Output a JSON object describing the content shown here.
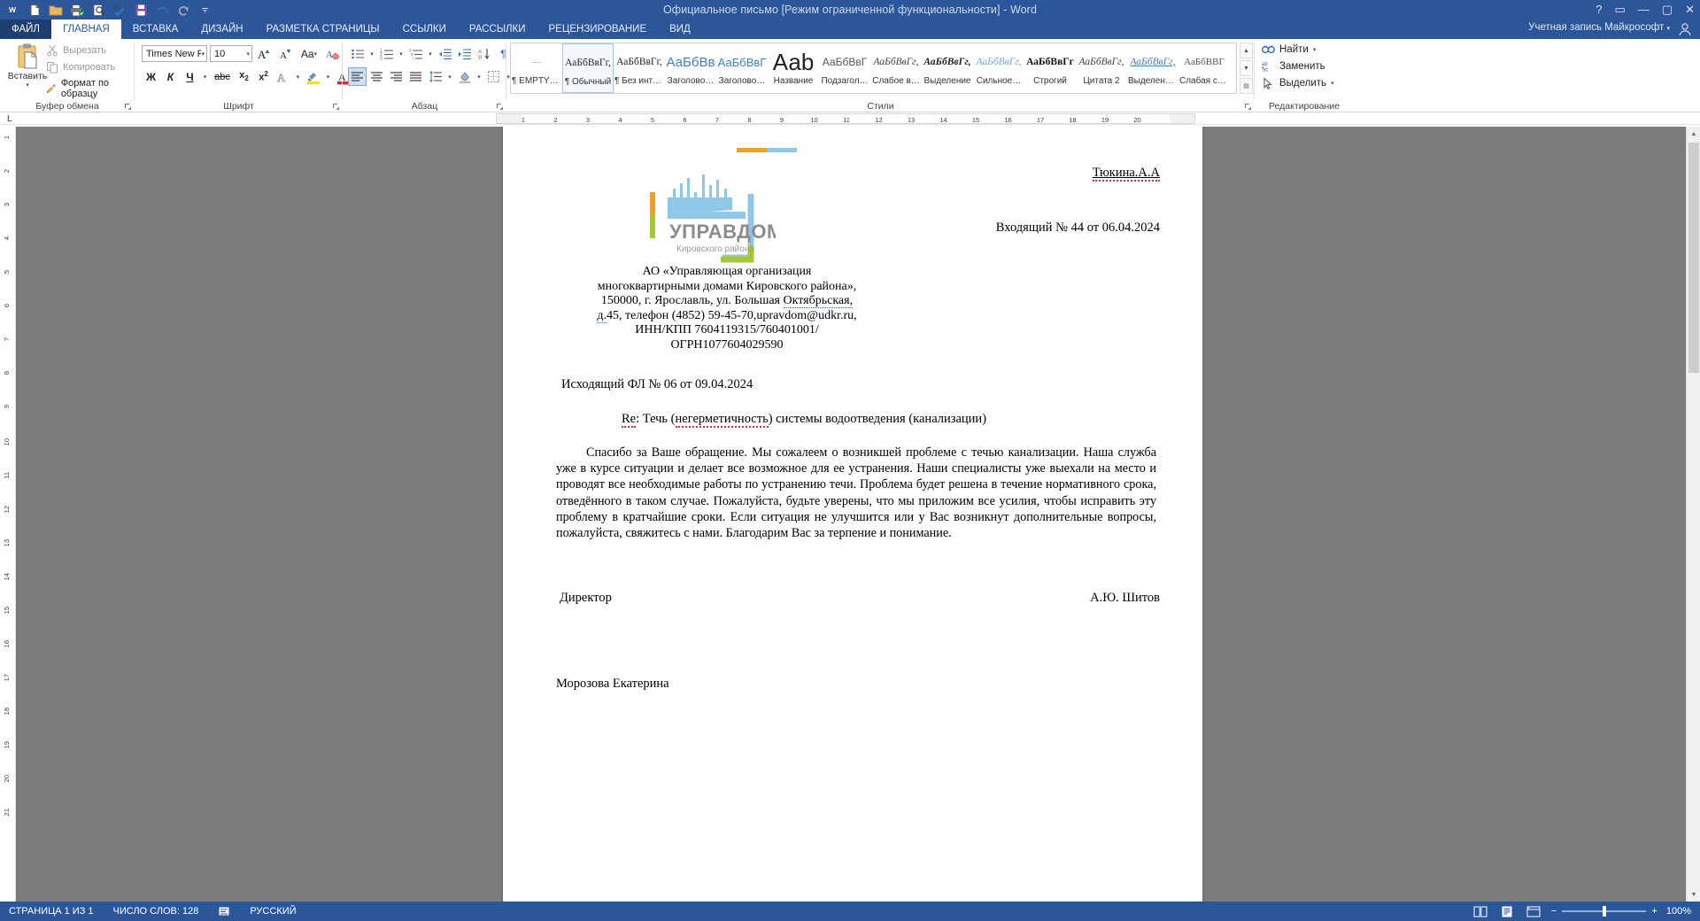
{
  "window": {
    "title": "Официальное письмо [Режим ограниченной функциональности] - Word",
    "minimize": "—",
    "maximize": "▢",
    "close": "✕",
    "help": "?",
    "ribbon_display": "▭"
  },
  "quick_access": [
    {
      "name": "word-logo-icon",
      "glyph": "W"
    },
    {
      "name": "new-document-icon",
      "glyph": "🗋"
    },
    {
      "name": "open-folder-icon",
      "glyph": "🗀"
    },
    {
      "name": "print-icon",
      "glyph": "🖶"
    },
    {
      "name": "print-preview-icon",
      "glyph": "🔍"
    },
    {
      "name": "spelling-check-icon",
      "glyph": "ABC"
    },
    {
      "name": "save-icon",
      "glyph": "💾"
    },
    {
      "name": "undo-icon",
      "glyph": "↩"
    },
    {
      "name": "redo-icon",
      "glyph": "↻"
    },
    {
      "name": "customize-qat-icon",
      "glyph": "▾"
    }
  ],
  "tabs": {
    "file": "ФАЙЛ",
    "items": [
      {
        "label": "ГЛАВНАЯ",
        "active": true
      },
      {
        "label": "ВСТАВКА",
        "active": false
      },
      {
        "label": "ДИЗАЙН",
        "active": false
      },
      {
        "label": "РАЗМЕТКА СТРАНИЦЫ",
        "active": false
      },
      {
        "label": "ССЫЛКИ",
        "active": false
      },
      {
        "label": "РАССЫЛКИ",
        "active": false
      },
      {
        "label": "РЕЦЕНЗИРОВАНИЕ",
        "active": false
      },
      {
        "label": "ВИД",
        "active": false
      }
    ],
    "account": "Учетная запись Майкрософт"
  },
  "ribbon": {
    "clipboard": {
      "group_label": "Буфер обмена",
      "paste_label": "Вставить",
      "cut_label": "Вырезать",
      "copy_label": "Копировать",
      "format_painter_label": "Формат по образцу"
    },
    "font": {
      "group_label": "Шрифт",
      "family": "Times New R",
      "size": "10",
      "grow_label": "A",
      "shrink_label": "A",
      "change_case_label": "Aa",
      "clear_format_label": "⌫",
      "bold": "Ж",
      "italic": "К",
      "underline": "Ч",
      "strikethrough": "abc",
      "subscript": "x₂",
      "superscript": "x²",
      "text_effects": "A",
      "highlight": "ab",
      "font_color": "A"
    },
    "paragraph": {
      "group_label": "Абзац"
    },
    "styles": {
      "group_label": "Стили",
      "items": [
        {
          "name": "¶ EMPTY_...",
          "preview": "—",
          "style": "empty",
          "selected": false
        },
        {
          "name": "¶ Обычный",
          "preview": "АаБбВвГг,",
          "style": "normal",
          "selected": true
        },
        {
          "name": "¶ Без инте…",
          "preview": "АаБбВвГг,",
          "style": "normal",
          "selected": false
        },
        {
          "name": "Заголово…",
          "preview": "АаБбВв",
          "style": "h1",
          "selected": false
        },
        {
          "name": "Заголово…",
          "preview": "АаБбВвГ",
          "style": "h2",
          "selected": false
        },
        {
          "name": "Название",
          "preview": "Ааb",
          "style": "title",
          "selected": false
        },
        {
          "name": "Подзагол…",
          "preview": "АаБбВвГ",
          "style": "subtitle",
          "selected": false
        },
        {
          "name": "Слабое в…",
          "preview": "АаБбВвГг,",
          "style": "subtle-em",
          "selected": false
        },
        {
          "name": "Выделение",
          "preview": "АаБбВвГг,",
          "style": "em",
          "selected": false
        },
        {
          "name": "Сильное…",
          "preview": "АаБбВвГг,",
          "style": "intense-em",
          "selected": false
        },
        {
          "name": "Строгий",
          "preview": "АаБбВвГг",
          "style": "strong",
          "selected": false
        },
        {
          "name": "Цитата 2",
          "preview": "АаБбВвГг,",
          "style": "quote",
          "selected": false
        },
        {
          "name": "Выделенн…",
          "preview": "АаБбВвГг,",
          "style": "intense-ref",
          "selected": false
        },
        {
          "name": "Слабая сс…",
          "preview": "АаБбВВГ",
          "style": "subtle-ref",
          "selected": false
        }
      ]
    },
    "editing": {
      "group_label": "Редактирование",
      "find_label": "Найти",
      "replace_label": "Заменить",
      "select_label": "Выделить"
    }
  },
  "ruler": {
    "corner_tab": "L",
    "h_ticks": [
      "1",
      "2",
      "3",
      "4",
      "5",
      "6",
      "7",
      "8",
      "9",
      "10",
      "11",
      "12",
      "13",
      "14",
      "15",
      "16",
      "17",
      "18",
      "19",
      "20"
    ],
    "v_ticks": [
      "1",
      "2",
      "3",
      "4",
      "5",
      "6",
      "7",
      "8",
      "9",
      "10",
      "11",
      "12",
      "13",
      "14",
      "15",
      "16",
      "17",
      "18",
      "19",
      "20",
      "21"
    ]
  },
  "document": {
    "logo": {
      "title": "УПРАВДОМ",
      "subtitle": "Кировского района",
      "accent_orange": "#f0a029",
      "accent_blue": "#8fc7e8",
      "accent_green": "#a7c736"
    },
    "recipient": "Тюкина.А.А",
    "incoming": "Входящий № 44 от 06.04.2024",
    "address_lines": [
      "АО «Управляющая организация",
      "многоквартирными домами Кировского района»,",
      "150000, г. Ярославль, ул. Большая Октябрьская,",
      "д.45, телефон (4852) 59-45-70,upravdom@udkr.ru,",
      "ИНН/КПП 7604119315/760401001/",
      "ОГРН1077604029590"
    ],
    "outgoing": "Исходящий ФЛ № 06      от 09.04.2024",
    "subject_prefix": "Re",
    "subject": ": Течь (негерметичность) системы водоотведения (канализации)",
    "subject_word_a": "Re",
    "subject_word_b": "негерметичность",
    "body": "Спасибо за Ваше обращение. Мы сожалеем о возникшей проблеме с течью канализации. Наша служба уже в курсе ситуации и делает все возможное для ее устранения. Наши специалисты уже выехали на место и проводят все необходимые работы по устранению течи. Проблема будет решена в течение нормативного срока, отведённого в таком случае. Пожалуйста, будьте уверены, что мы приложим все усилия, чтобы исправить эту проблему в кратчайшие сроки. Если ситуация не улучшится или у Вас возникнут дополнительные вопросы, пожалуйста, свяжитесь с нами. Благодарим Вас за терпение и понимание.",
    "signer_title": "Директор",
    "signer_name": "А.Ю. Шитов",
    "author": "Морозова Екатерина"
  },
  "status_bar": {
    "page": "СТРАНИЦА 1 ИЗ 1",
    "words": "ЧИСЛО СЛОВ: 128",
    "proofing_icon": "proofing-icon",
    "language": "РУССКИЙ",
    "zoom_out": "−",
    "zoom_in": "+",
    "zoom_level": "100%"
  }
}
